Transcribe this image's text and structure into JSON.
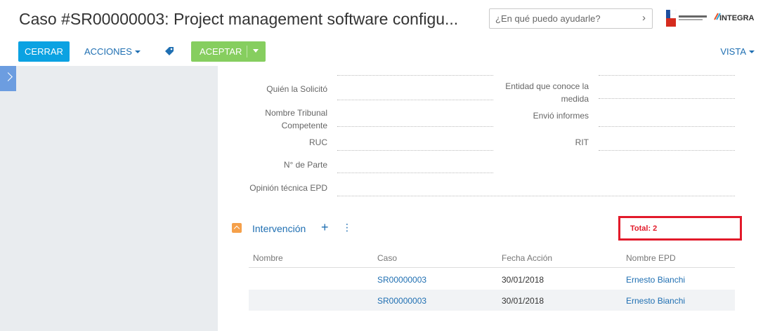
{
  "header": {
    "title": "Caso #SR00000003: Project management software configu...",
    "help_placeholder": "¿En qué puedo ayudarle?",
    "logo_text": "INTEGRA"
  },
  "toolbar": {
    "close_label": "CERRAR",
    "actions_label": "ACCIONES",
    "accept_label": "ACEPTAR",
    "view_label": "VISTA"
  },
  "fields": {
    "quien_solicito": "Quién la Solicitó",
    "entidad_medida": "Entidad que conoce la medida",
    "nombre_tribunal": "Nombre Tribunal Competente",
    "envio_informes": "Envió informes",
    "ruc": "RUC",
    "rit": "RIT",
    "numero_parte": "N° de Parte",
    "opinion_tecnica": "Opinión técnica EPD"
  },
  "section": {
    "title": "Intervención",
    "total_label": "Total: 2"
  },
  "table": {
    "columns": [
      "Nombre",
      "Caso",
      "Fecha Acción",
      "Nombre EPD"
    ],
    "rows": [
      {
        "nombre": "",
        "caso": "SR00000003",
        "fecha": "30/01/2018",
        "epd": "Ernesto Bianchi"
      },
      {
        "nombre": "",
        "caso": "SR00000003",
        "fecha": "30/01/2018",
        "epd": "Ernesto Bianchi"
      }
    ]
  },
  "colors": {
    "primary": "#0ba2e2",
    "accept": "#86ce5f",
    "link": "#1f6fb2",
    "highlight": "#e21a2a"
  }
}
